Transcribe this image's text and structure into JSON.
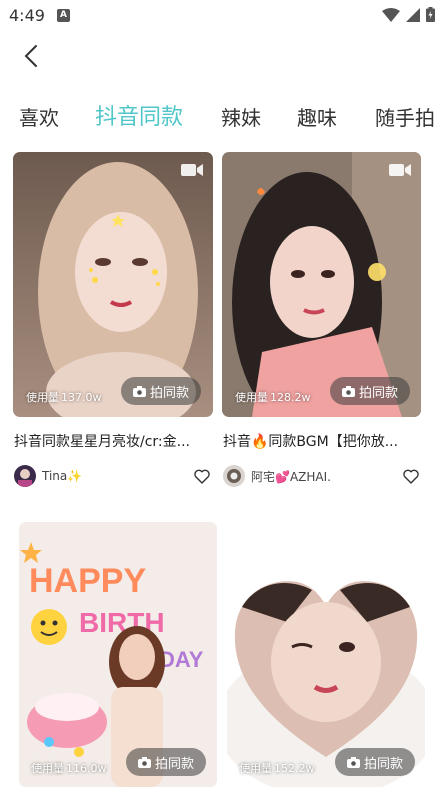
{
  "status_bar": {
    "time": "4:49",
    "notif_letter": "A"
  },
  "header": {
    "back_icon": "chevron-left-icon"
  },
  "tabs": [
    {
      "label": "喜欢",
      "active": false
    },
    {
      "label": "抖音同款",
      "active": true
    },
    {
      "label": "辣妹",
      "active": false
    },
    {
      "label": "趣味",
      "active": false
    },
    {
      "label": "随手拍",
      "active": false
    }
  ],
  "colors": {
    "accent": "#4fc6c9"
  },
  "cards": [
    {
      "usage_label": "使用量",
      "usage_count": "137.0w",
      "button_label": "拍同款",
      "title": "抖音同款星星月亮妆/cr:金...",
      "author": "Tina✨"
    },
    {
      "usage_label": "使用量",
      "usage_count": "128.2w",
      "button_label": "拍同款",
      "title": "抖音🔥同款BGM【把你放...",
      "author": "阿宅💕AZHAI."
    },
    {
      "usage_label": "使用量",
      "usage_count": "116.0w",
      "button_label": "拍同款"
    },
    {
      "usage_label": "使用量",
      "usage_count": "152.2w",
      "button_label": "拍同款"
    }
  ]
}
